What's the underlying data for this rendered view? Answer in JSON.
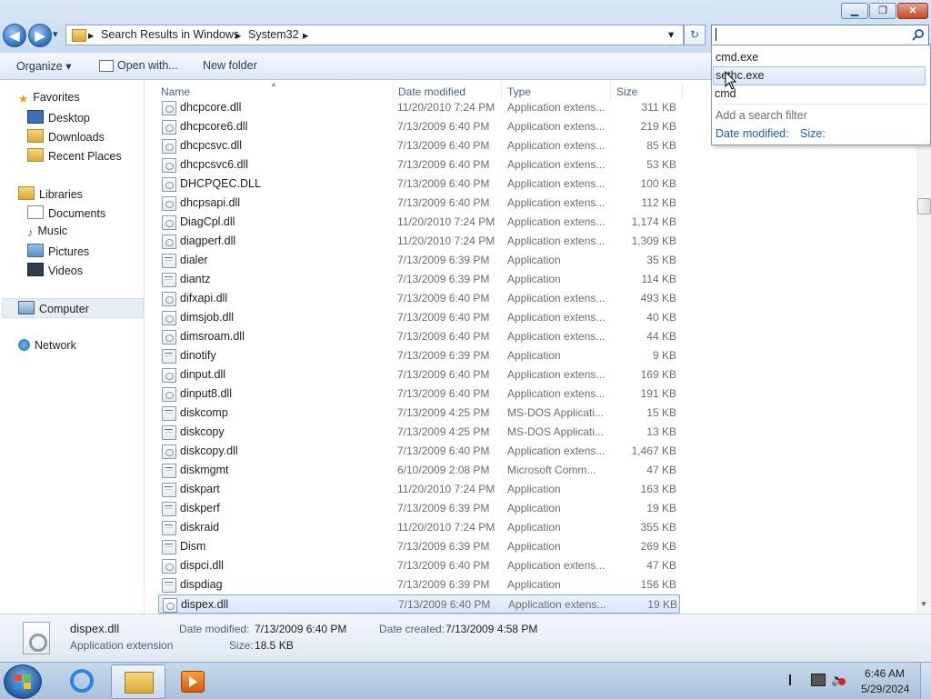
{
  "window": {
    "minimize_glyph": "▁",
    "restore_glyph": "❐",
    "close_glyph": "✕"
  },
  "nav": {
    "back_glyph": "◀",
    "forward_glyph": "▶",
    "history_glyph": "▾"
  },
  "address": {
    "crumbs": [
      "Search Results in Windows",
      "System32"
    ],
    "separator": "▸",
    "dropdown_glyph": "▾",
    "refresh_glyph": "↻"
  },
  "search": {
    "value": "",
    "icon": "magnifier-icon"
  },
  "suggestions": {
    "items": [
      "cmd.exe",
      "sethc.exe",
      "cmd"
    ],
    "filter_prompt": "Add a search filter",
    "filters": [
      "Date modified:",
      "Size:"
    ]
  },
  "toolbar": {
    "organize": "Organize",
    "open_with": "Open with...",
    "new_folder": "New folder"
  },
  "sidebar": {
    "favorites": "Favorites",
    "favorites_items": [
      "Desktop",
      "Downloads",
      "Recent Places"
    ],
    "libraries": "Libraries",
    "libraries_items": [
      "Documents",
      "Music",
      "Pictures",
      "Videos"
    ],
    "computer": "Computer",
    "network": "Network"
  },
  "columns": {
    "name": "Name",
    "date": "Date modified",
    "type": "Type",
    "size": "Size"
  },
  "files": [
    {
      "name": "dhcpcore.dll",
      "date": "11/20/2010 7:24 PM",
      "type": "Application extens...",
      "size": "311 KB",
      "kind": "dll"
    },
    {
      "name": "dhcpcore6.dll",
      "date": "7/13/2009 6:40 PM",
      "type": "Application extens...",
      "size": "219 KB",
      "kind": "dll"
    },
    {
      "name": "dhcpcsvc.dll",
      "date": "7/13/2009 6:40 PM",
      "type": "Application extens...",
      "size": "85 KB",
      "kind": "dll"
    },
    {
      "name": "dhcpcsvc6.dll",
      "date": "7/13/2009 6:40 PM",
      "type": "Application extens...",
      "size": "53 KB",
      "kind": "dll"
    },
    {
      "name": "DHCPQEC.DLL",
      "date": "7/13/2009 6:40 PM",
      "type": "Application extens...",
      "size": "100 KB",
      "kind": "dll"
    },
    {
      "name": "dhcpsapi.dll",
      "date": "7/13/2009 6:40 PM",
      "type": "Application extens...",
      "size": "112 KB",
      "kind": "dll"
    },
    {
      "name": "DiagCpl.dll",
      "date": "11/20/2010 7:24 PM",
      "type": "Application extens...",
      "size": "1,174 KB",
      "kind": "dll"
    },
    {
      "name": "diagperf.dll",
      "date": "11/20/2010 7:24 PM",
      "type": "Application extens...",
      "size": "1,309 KB",
      "kind": "dll"
    },
    {
      "name": "dialer",
      "date": "7/13/2009 6:39 PM",
      "type": "Application",
      "size": "35 KB",
      "kind": "exe"
    },
    {
      "name": "diantz",
      "date": "7/13/2009 6:39 PM",
      "type": "Application",
      "size": "114 KB",
      "kind": "exe"
    },
    {
      "name": "difxapi.dll",
      "date": "7/13/2009 6:40 PM",
      "type": "Application extens...",
      "size": "493 KB",
      "kind": "dll"
    },
    {
      "name": "dimsjob.dll",
      "date": "7/13/2009 6:40 PM",
      "type": "Application extens...",
      "size": "40 KB",
      "kind": "dll"
    },
    {
      "name": "dimsroam.dll",
      "date": "7/13/2009 6:40 PM",
      "type": "Application extens...",
      "size": "44 KB",
      "kind": "dll"
    },
    {
      "name": "dinotify",
      "date": "7/13/2009 6:39 PM",
      "type": "Application",
      "size": "9 KB",
      "kind": "exe"
    },
    {
      "name": "dinput.dll",
      "date": "7/13/2009 6:40 PM",
      "type": "Application extens...",
      "size": "169 KB",
      "kind": "dll"
    },
    {
      "name": "dinput8.dll",
      "date": "7/13/2009 6:40 PM",
      "type": "Application extens...",
      "size": "191 KB",
      "kind": "dll"
    },
    {
      "name": "diskcomp",
      "date": "7/13/2009 4:25 PM",
      "type": "MS-DOS Applicati...",
      "size": "15 KB",
      "kind": "exe"
    },
    {
      "name": "diskcopy",
      "date": "7/13/2009 4:25 PM",
      "type": "MS-DOS Applicati...",
      "size": "13 KB",
      "kind": "exe"
    },
    {
      "name": "diskcopy.dll",
      "date": "7/13/2009 6:40 PM",
      "type": "Application extens...",
      "size": "1,467 KB",
      "kind": "dll"
    },
    {
      "name": "diskmgmt",
      "date": "6/10/2009 2:08 PM",
      "type": "Microsoft Comm...",
      "size": "47 KB",
      "kind": "exe"
    },
    {
      "name": "diskpart",
      "date": "11/20/2010 7:24 PM",
      "type": "Application",
      "size": "163 KB",
      "kind": "exe"
    },
    {
      "name": "diskperf",
      "date": "7/13/2009 6:39 PM",
      "type": "Application",
      "size": "19 KB",
      "kind": "exe"
    },
    {
      "name": "diskraid",
      "date": "11/20/2010 7:24 PM",
      "type": "Application",
      "size": "355 KB",
      "kind": "exe"
    },
    {
      "name": "Dism",
      "date": "7/13/2009 6:39 PM",
      "type": "Application",
      "size": "269 KB",
      "kind": "exe"
    },
    {
      "name": "dispci.dll",
      "date": "7/13/2009 6:40 PM",
      "type": "Application extens...",
      "size": "47 KB",
      "kind": "dll"
    },
    {
      "name": "dispdiag",
      "date": "7/13/2009 6:39 PM",
      "type": "Application",
      "size": "156 KB",
      "kind": "exe"
    },
    {
      "name": "dispex.dll",
      "date": "7/13/2009 6:40 PM",
      "type": "Application extens...",
      "size": "19 KB",
      "kind": "dll",
      "selected": true
    }
  ],
  "details": {
    "name": "dispex.dll",
    "kind": "Application extension",
    "date_modified_label": "Date modified:",
    "date_modified": "7/13/2009 6:40 PM",
    "date_created_label": "Date created:",
    "date_created": "7/13/2009 4:58 PM",
    "size_label": "Size:",
    "size": "18.5 KB"
  },
  "taskbar": {
    "time": "6:46 AM",
    "date": "5/29/2024"
  },
  "colors": {
    "accent": "#2f6fbe",
    "selection_border": "#84acdd",
    "filter_link": "#1a5fb4"
  }
}
